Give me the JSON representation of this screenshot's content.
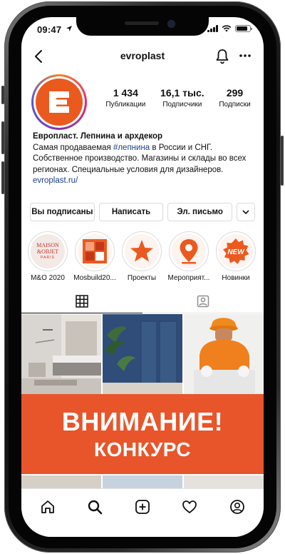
{
  "status_bar": {
    "time": "09:47"
  },
  "header": {
    "username": "evroplast"
  },
  "profile": {
    "stats": [
      {
        "value": "1 434",
        "label": "Публикации"
      },
      {
        "value": "16,1 тыс.",
        "label": "Подписчики"
      },
      {
        "value": "299",
        "label": "Подписки"
      }
    ],
    "name": "Европласт. Лепнина и архдекор",
    "bio_before_tag": "Самая продаваемая ",
    "bio_tag": "#лепнина",
    "bio_after_tag": " в России и СНГ.",
    "bio_line2": "Собственное производство. Магазины и склады во всех регионах. Специальные условия для дизайнеров.",
    "link": "evroplast.ru/"
  },
  "actions": {
    "following": "Вы подписаны",
    "message": "Написать",
    "email": "Эл. письмо"
  },
  "highlights": [
    {
      "label": "M&O 2020",
      "cover_text": [
        "MAISON",
        "&OBJET",
        "PARIS"
      ]
    },
    {
      "label": "Mosbuild20..."
    },
    {
      "label": "Проекты"
    },
    {
      "label": "Мероприят..."
    },
    {
      "label": "Новинки",
      "cover_text": [
        "NEW"
      ]
    }
  ],
  "banner": {
    "line1": "ВНИМАНИЕ!",
    "line2": "КОНКУРС"
  },
  "colors": {
    "brand_orange": "#ea5a1f",
    "link_blue": "#1b3f8a"
  }
}
